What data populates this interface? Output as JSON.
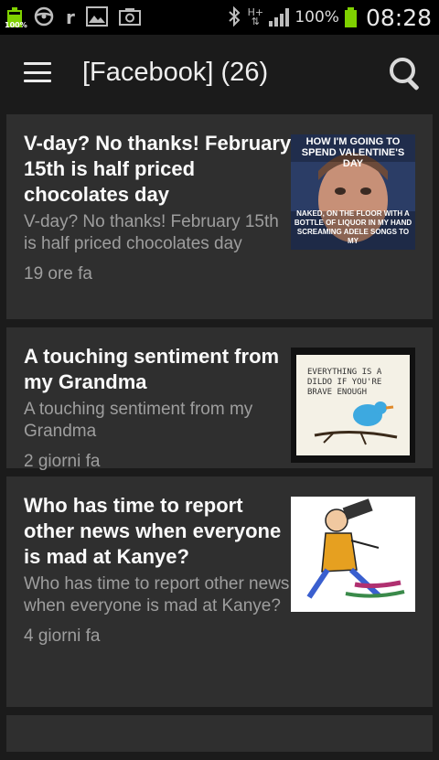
{
  "status_bar": {
    "battery_small_pct": "100%",
    "battery_pct": "100%",
    "time": "08:28",
    "network": "H+"
  },
  "app_bar": {
    "title": "[Facebook] (26)"
  },
  "cards": [
    {
      "title": "V-day? No thanks! February 15th is half priced chocolates day",
      "description": "V-day? No thanks! February 15th is half priced chocolates day",
      "time": "19 ore fa",
      "thumb_top": "HOW I'M GOING TO SPEND VALENTINE'S DAY",
      "thumb_bottom": "NAKED, ON THE FLOOR WITH A BOTTLE OF LIQUOR IN MY HAND SCREAMING ADELE SONGS TO MY"
    },
    {
      "title": "A touching sentiment from my Grandma",
      "description": "A touching sentiment from my Grandma",
      "time": "2 giorni fa",
      "thumb_text": "EVERYTHING IS A DILDO IF YOU'RE BRAVE ENOUGH"
    },
    {
      "title": "Who has time to report other news when everyone is mad at Kanye?",
      "description": "Who has time to report other news when everyone is mad at Kanye?",
      "time": "4 giorni fa"
    }
  ]
}
